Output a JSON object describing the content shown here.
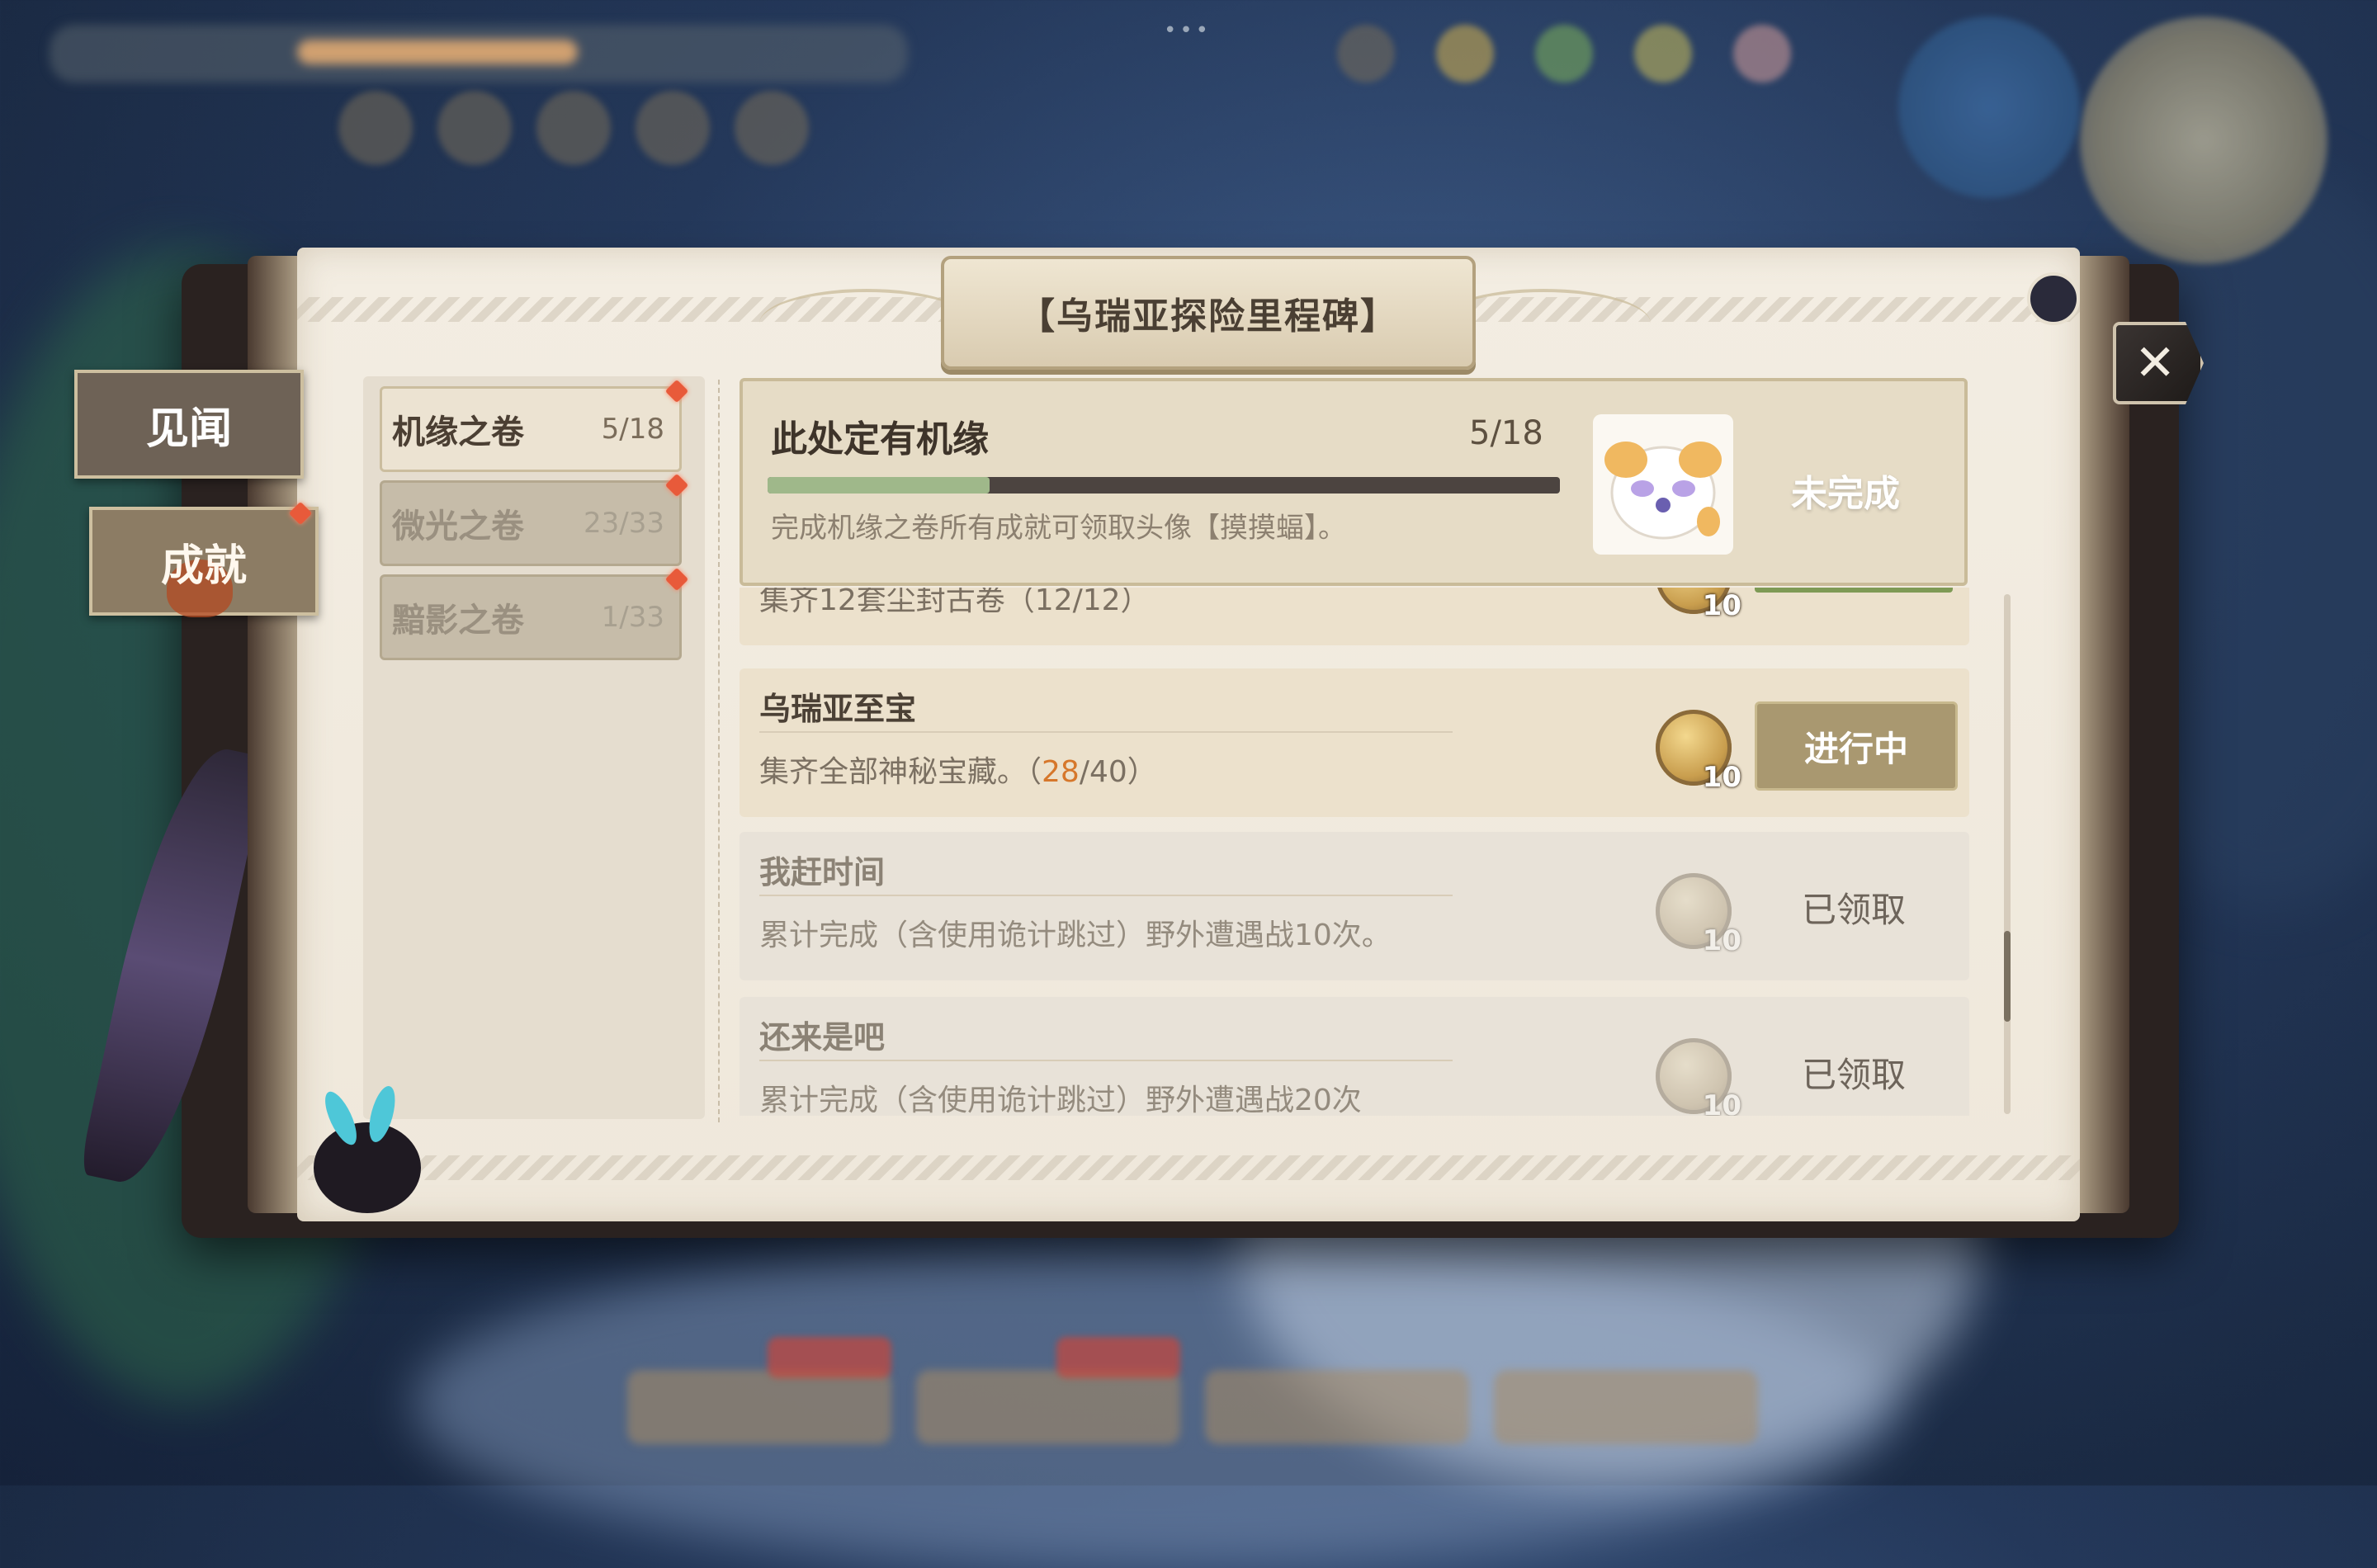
{
  "book": {
    "title": "【乌瑞亚探险里程碑】",
    "close_icon": "close-icon"
  },
  "side_tabs": [
    {
      "label": "见闻",
      "active": false
    },
    {
      "label": "成就",
      "active": true,
      "badge": true
    }
  ],
  "scrolls": [
    {
      "name": "机缘之卷",
      "count": "5/18",
      "active": true,
      "badge": true
    },
    {
      "name": "微光之卷",
      "count": "23/33",
      "active": false,
      "badge": true
    },
    {
      "name": "黯影之卷",
      "count": "1/33",
      "active": false,
      "badge": true
    }
  ],
  "header": {
    "title": "此处定有机缘",
    "count": "5/18",
    "progress": 0.28,
    "description": "完成机缘之卷所有成就可领取头像【摸摸蝠】。",
    "status": "未完成",
    "avatar_icon": "avatar-mascot-icon"
  },
  "achievements": [
    {
      "title": "",
      "desc": "集齐12套尘封古卷（12/12）",
      "reward": "10",
      "status": "",
      "state": "active"
    },
    {
      "title": "乌瑞亚至宝",
      "desc_prefix": "集齐全部神秘宝藏。（",
      "desc_highlight": "28",
      "desc_suffix": "/40）",
      "reward": "10",
      "status": "进行中",
      "state": "active"
    },
    {
      "title": "我赶时间",
      "desc": "累计完成（含使用诡计跳过）野外遭遇战10次。",
      "reward": "10",
      "status": "已领取",
      "state": "claimed"
    },
    {
      "title": "还来是吧",
      "desc": "累计完成（含使用诡计跳过）野外遭遇战20次",
      "reward": "10",
      "status": "已领取",
      "state": "claimed"
    }
  ],
  "colors": {
    "highlight": "#d6772b",
    "progress_fill": "#9fb88a",
    "badge": "#e85a3a"
  }
}
